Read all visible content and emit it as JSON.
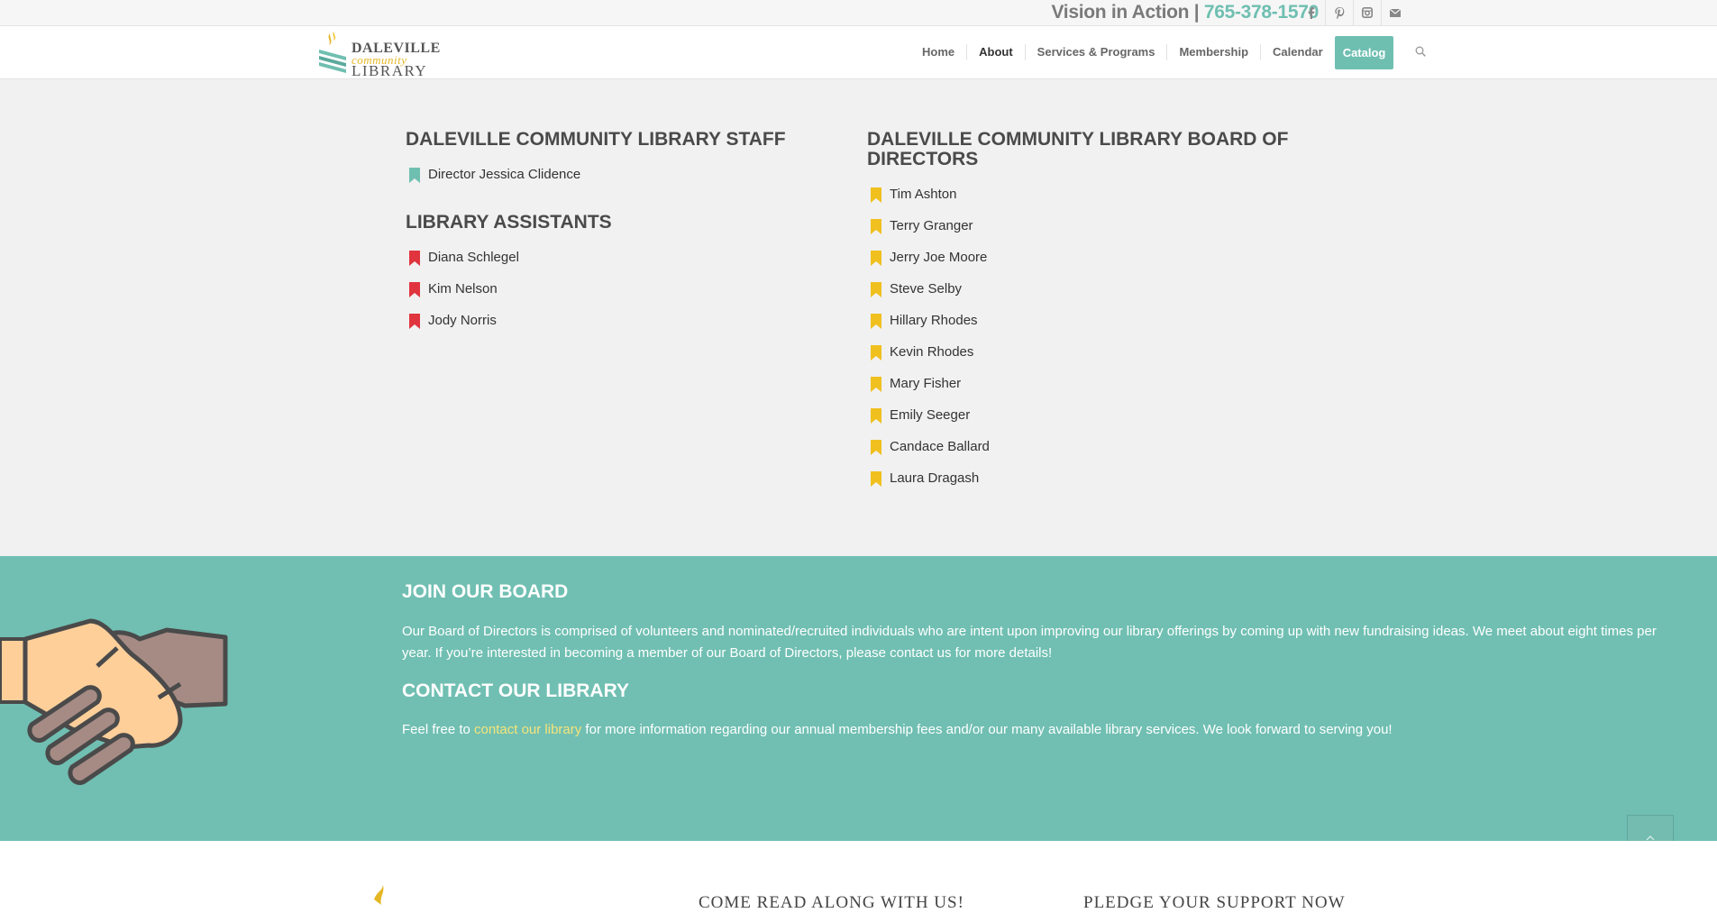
{
  "topbar": {
    "tagline": "Vision in Action | ",
    "phone": "765-378-1570",
    "social_icons": [
      "facebook-icon",
      "pinterest-icon",
      "instagram-icon",
      "mail-icon"
    ]
  },
  "header": {
    "logo": {
      "line1": "DALEVILLE",
      "line2": "community",
      "line3": "LIBRARY"
    },
    "nav": [
      {
        "label": "Home",
        "active": false
      },
      {
        "label": "About",
        "active": true
      },
      {
        "label": "Services & Programs",
        "active": false
      },
      {
        "label": "Membership",
        "active": false
      },
      {
        "label": "Calendar",
        "active": false
      }
    ],
    "catalog_label": "Catalog",
    "search_icon": "search-icon"
  },
  "staff": {
    "staff_heading": "DALEVILLE COMMUNITY LIBRARY STAFF",
    "director": "Director Jessica Clidence",
    "assistants_heading": "LIBRARY ASSISTANTS",
    "assistants": [
      "Diana Schlegel",
      "Kim Nelson",
      "Jody Norris"
    ],
    "board_heading": "DALEVILLE COMMUNITY LIBRARY BOARD OF DIRECTORS",
    "board": [
      "Tim Ashton",
      "Terry Granger",
      "Jerry Joe Moore",
      "Steve Selby",
      "Hillary Rhodes",
      "Kevin Rhodes",
      "Mary Fisher",
      "Emily Seeger",
      "Candace Ballard",
      "Laura Dragash"
    ]
  },
  "join": {
    "heading": "JOIN OUR BOARD",
    "text": "Our Board of Directors is comprised of volunteers and nominated/recruited individuals who are intent upon improving our library offerings by coming up with new fundraising ideas. We meet about eight times per year. If you’re interested in becoming a member of our Board of Directors, please contact us for more details!",
    "contact_heading": "CONTACT OUR LIBRARY",
    "contact_prefix": "Feel free to ",
    "contact_link": "contact our library",
    "contact_suffix": " for more information regarding our annual membership fees and/or our many available library services. We look forward to serving you!"
  },
  "footer": {
    "col2_title": "COME READ ALONG WITH US!",
    "col3_title": "PLEDGE YOUR SUPPORT NOW"
  },
  "colors": {
    "teal": "#6fbfb1",
    "bookmark_teal": "#6fbfb1",
    "bookmark_red": "#e0353e",
    "bookmark_yellow": "#f0c01f",
    "link_yellow": "#f6e47a"
  }
}
